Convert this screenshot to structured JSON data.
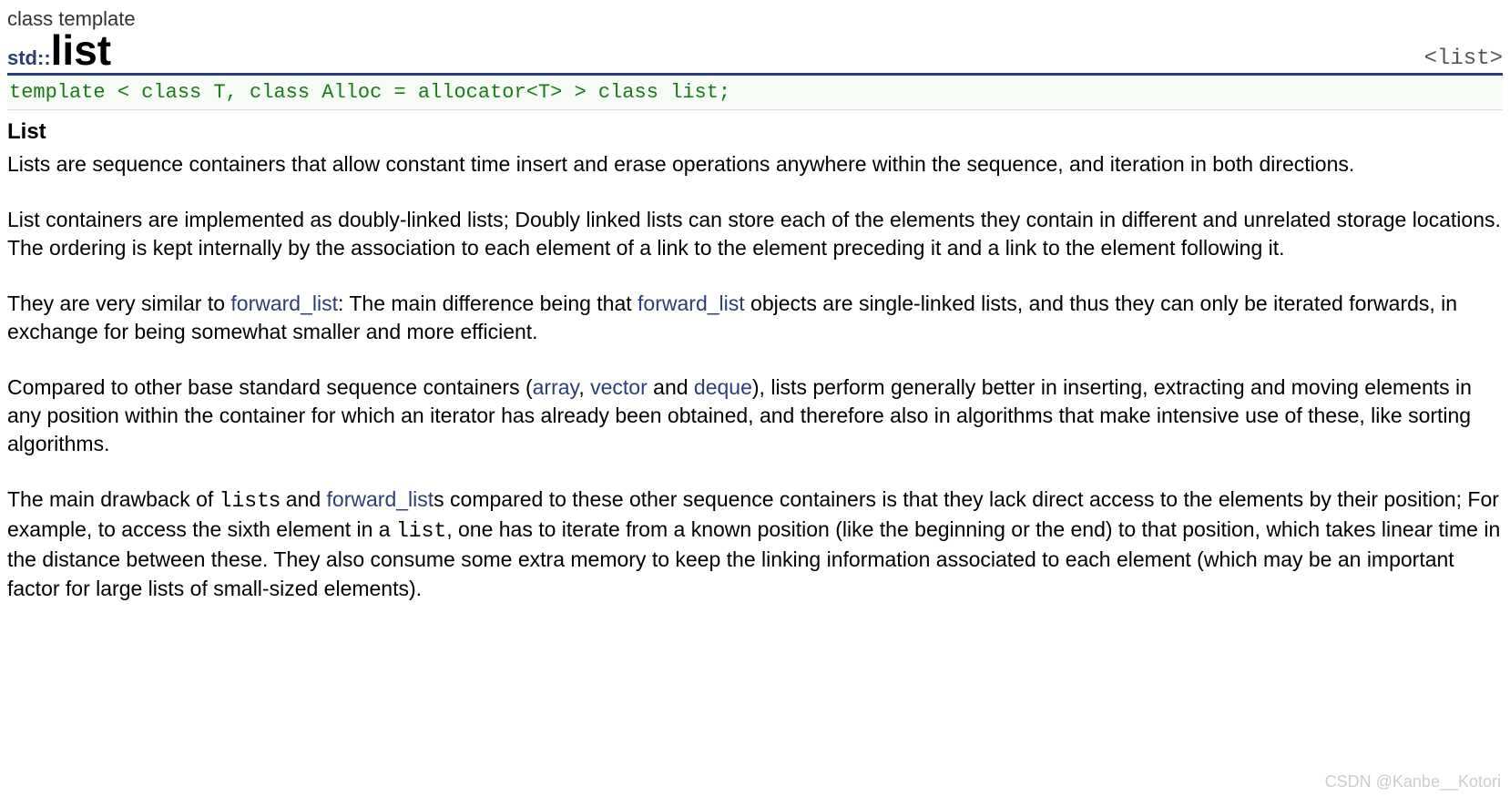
{
  "header": {
    "classtemplate": "class template",
    "std": "std::",
    "name": "list",
    "include": "<list>"
  },
  "decl": "template < class T, class Alloc = allocator<T> > class list;",
  "section_title": "List",
  "p1": "Lists are sequence containers that allow constant time insert and erase operations anywhere within the sequence, and iteration in both directions.",
  "p2": "List containers are implemented as doubly-linked lists; Doubly linked lists can store each of the elements they contain in different and unrelated storage locations. The ordering is kept internally by the association to each element of a link to the element preceding it and a link to the element following it.",
  "p3": {
    "a": "They are very similar to ",
    "link1": "forward_list",
    "b": ": The main difference being that ",
    "link2": "forward_list",
    "c": " objects are single-linked lists, and thus they can only be iterated forwards, in exchange for being somewhat smaller and more efficient."
  },
  "p4": {
    "a": "Compared to other base standard sequence containers (",
    "link1": "array",
    "b": ", ",
    "link2": "vector",
    "c": " and ",
    "link3": "deque",
    "d": "), lists perform generally better in inserting, extracting and moving elements in any position within the container for which an iterator has already been obtained, and therefore also in algorithms that make intensive use of these, like sorting algorithms."
  },
  "p5": {
    "a": "The main drawback of ",
    "mono1": "list",
    "b": "s and ",
    "link1": "forward_list",
    "c": "s compared to these other sequence containers is that they lack direct access to the elements by their position; For example, to access the sixth element in a ",
    "mono2": "list",
    "d": ", one has to iterate from a known position (like the beginning or the end) to that position, which takes linear time in the distance between these. They also consume some extra memory to keep the linking information associated to each element (which may be an important factor for large lists of small-sized elements)."
  },
  "watermark": "CSDN @Kanbe__Kotori"
}
